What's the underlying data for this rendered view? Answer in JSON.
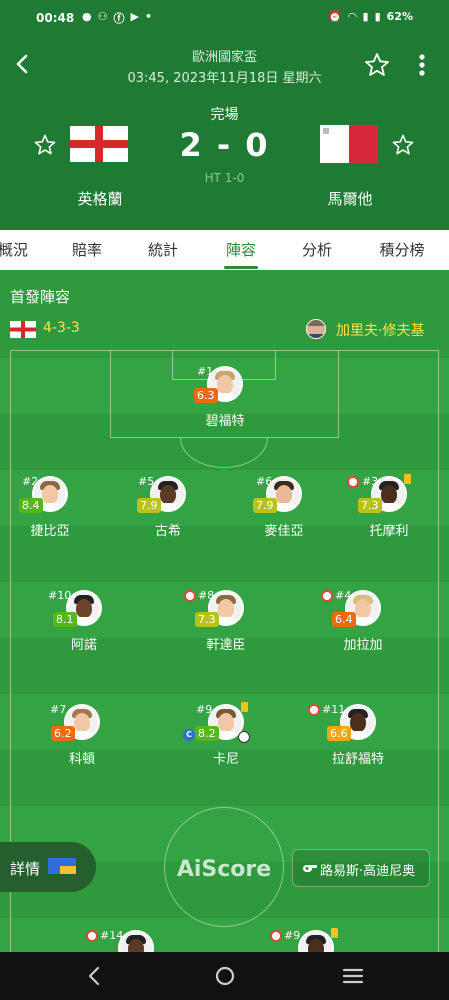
{
  "status_bar": {
    "time": "00:48",
    "battery": "62%",
    "notif_icons": [
      "chat-icon",
      "link-icon",
      "facebook-icon",
      "youtube-icon",
      "dot-icon"
    ]
  },
  "match": {
    "league": "歐洲國家盃",
    "datetime": "03:45, 2023年11月18日 星期六",
    "status": "完場",
    "score": "2 - 0",
    "halftime": "HT 1-0",
    "home_team": "英格蘭",
    "away_team": "馬爾他"
  },
  "tabs": [
    {
      "label": "概況",
      "active": false
    },
    {
      "label": "賠率",
      "active": false
    },
    {
      "label": "統計",
      "active": false
    },
    {
      "label": "陣容",
      "active": true
    },
    {
      "label": "分析",
      "active": false
    },
    {
      "label": "積分榜",
      "active": false
    }
  ],
  "lineup": {
    "title": "首發陣容",
    "formation": "4-3-3",
    "coach": "加里夫·修夫基"
  },
  "players": [
    {
      "num": "#1",
      "rating": "6.3",
      "name": "碧福特",
      "rating_color": "#f06a16",
      "sub": false,
      "card": false,
      "captain": false,
      "goal": false
    },
    {
      "num": "#2",
      "rating": "8.4",
      "name": "捷比亞",
      "rating_color": "#57b61c",
      "sub": false,
      "card": false,
      "captain": false,
      "goal": false
    },
    {
      "num": "#5",
      "rating": "7.9",
      "name": "古希",
      "rating_color": "#b7c21a",
      "sub": false,
      "card": false,
      "captain": false,
      "goal": false
    },
    {
      "num": "#6",
      "rating": "7.9",
      "name": "麥佳亞",
      "rating_color": "#b7c21a",
      "sub": false,
      "card": false,
      "captain": false,
      "goal": false
    },
    {
      "num": "#3",
      "rating": "7.3",
      "name": "托摩利",
      "rating_color": "#b7c21a",
      "sub": true,
      "card": true,
      "captain": false,
      "goal": false
    },
    {
      "num": "#10",
      "rating": "8.1",
      "name": "阿諾",
      "rating_color": "#57b61c",
      "sub": false,
      "card": false,
      "captain": false,
      "goal": false
    },
    {
      "num": "#8",
      "rating": "7.3",
      "name": "軒達臣",
      "rating_color": "#b7c21a",
      "sub": true,
      "card": false,
      "captain": false,
      "goal": false
    },
    {
      "num": "#4",
      "rating": "6.4",
      "name": "加拉加",
      "rating_color": "#f06a16",
      "sub": true,
      "card": false,
      "captain": false,
      "goal": false
    },
    {
      "num": "#7",
      "rating": "6.2",
      "name": "科頓",
      "rating_color": "#f06a16",
      "sub": false,
      "card": false,
      "captain": false,
      "goal": false
    },
    {
      "num": "#9",
      "rating": "8.2",
      "name": "卡尼",
      "rating_color": "#57b61c",
      "sub": false,
      "card": true,
      "captain": true,
      "goal": true
    },
    {
      "num": "#11",
      "rating": "6.6",
      "name": "拉舒福特",
      "rating_color": "#f0a416",
      "sub": true,
      "card": false,
      "captain": false,
      "goal": false
    },
    {
      "num": "#14",
      "rating": "",
      "name": "",
      "rating_color": "#57b61c",
      "sub": true,
      "card": false,
      "captain": false,
      "goal": false
    },
    {
      "num": "#9",
      "rating": "",
      "name": "",
      "rating_color": "#57b61c",
      "sub": true,
      "card": true,
      "captain": false,
      "goal": false
    }
  ],
  "overlay": {
    "details_label": "詳情",
    "watermark": "AiScore",
    "referee": "路易斯·高迪尼奥"
  },
  "colors": {
    "header_bg": "#1f7a33",
    "pitch": "#2e9a3d",
    "accent": "#2b8a3e",
    "formation_text": "#ffe24a"
  }
}
